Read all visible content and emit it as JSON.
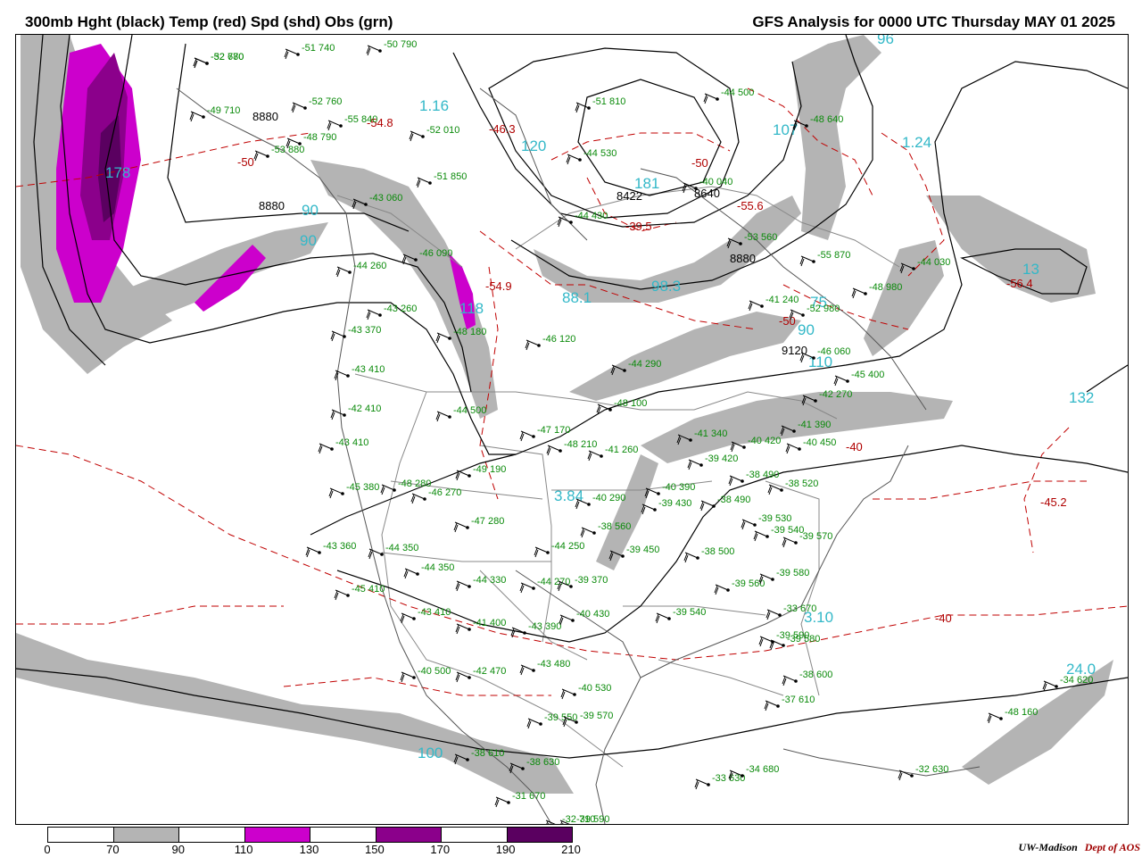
{
  "header": {
    "left_title": "300mb Hght (black) Temp (red) Spd (shd) Obs (grn)",
    "right_title": "GFS Analysis for 0000 UTC Thursday  MAY 01 2025"
  },
  "colors": {
    "height_contour": "#000000",
    "temp_contour": "#c00000",
    "obs": "#0a8a0a",
    "speed_label": "#33b8c8",
    "borders": "#888888"
  },
  "legend": {
    "ticks": [
      "0",
      "70",
      "90",
      "110",
      "130",
      "150",
      "170",
      "190",
      "210"
    ],
    "colors": [
      "#ffffff",
      "#b4b4b4",
      "#ffffff",
      "#cc00cc",
      "#ffffff",
      "#8b008b",
      "#ffffff",
      "#5a0060"
    ]
  },
  "credit": {
    "org": "UW-Madison",
    "dept": "Dept of AOS"
  },
  "map": {
    "height_labels": [
      "8880",
      "8880",
      "8422",
      "8640",
      "8880",
      "9120"
    ],
    "speed_labels": [
      "178",
      "90",
      "90",
      "1.16",
      "120",
      "181",
      "107",
      "1.24",
      "88.1",
      "98.3",
      "118",
      "75",
      "90",
      "110",
      "132",
      "3.84",
      "3.10",
      "24.0",
      "100",
      "96",
      "13"
    ],
    "temp_labels": [
      "-46.3",
      "-54.8",
      "-39.5",
      "-55.6",
      "-54.9",
      "-56.4",
      "-45.2",
      "-40",
      "-40",
      "-50",
      "-50",
      "-50"
    ],
    "obs": [
      "-52  770",
      "-51  740",
      "-50  790",
      "-49  710",
      "-52  760",
      "-55  840",
      "-48  790",
      "-51  850",
      "-53  880",
      "-43  060",
      "-46  090",
      "-44  260",
      "-43  260",
      "-43  370",
      "-43  410",
      "-42  410",
      "-43  410",
      "-45  380",
      "-48  280",
      "-46  270",
      "-49  190",
      "-47  280",
      "-43  360",
      "-44  350",
      "-44  350",
      "-44  330",
      "-45  410",
      "-43  410",
      "-41  400",
      "-43  390",
      "-40  500",
      "-42  470",
      "-43  480",
      "-40  530",
      "-39  550",
      "-39  570",
      "-38  610",
      "-38  630",
      "-31  670",
      "-32  710",
      "-47  170",
      "-48  210",
      "-41  260",
      "-40  290",
      "-44  250",
      "-44  270",
      "-39  370",
      "-40  430",
      "-38  560",
      "-39  450",
      "-40  390",
      "-39  430",
      "-38  490",
      "-38  500",
      "-39  540",
      "-39  560",
      "-39  580",
      "-39  590",
      "-38  600",
      "-37  610",
      "-41  340",
      "-40  420",
      "-39  420",
      "-38  490",
      "-38  520",
      "-39  530",
      "-39  540",
      "-39  570",
      "-41  390",
      "-40  450",
      "-44  500",
      "-48  640",
      "-40  040",
      "-53  560",
      "-55  870",
      "-48  980",
      "-44  030",
      "-41  240",
      "-52  980",
      "-46  060",
      "-45  400",
      "-42  270",
      "-44  290",
      "-48  100",
      "-48  180",
      "-46  120",
      "-52  010",
      "-51  810",
      "-44  530",
      "-44  430",
      "-44  500",
      "-48  160",
      "-34  620",
      "-32  630",
      "-33  630",
      "-34  680",
      "-33  670",
      "-39  580",
      "-39  590",
      "-32  680"
    ]
  }
}
